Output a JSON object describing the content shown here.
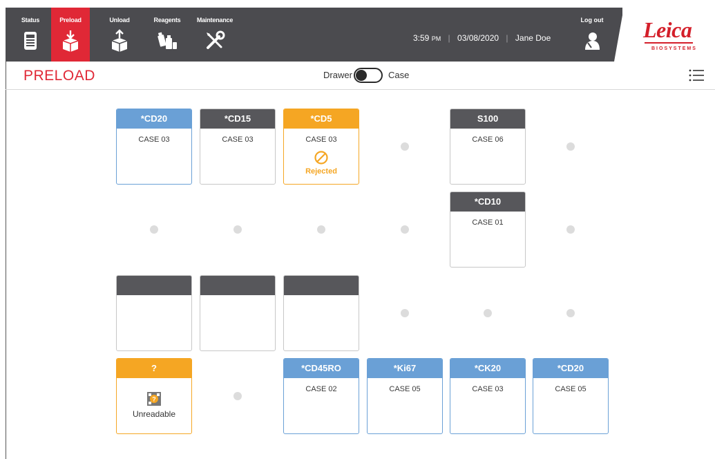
{
  "nav": {
    "items": [
      {
        "label": "Status",
        "icon": "instrument-icon"
      },
      {
        "label": "Preload",
        "icon": "tray-download-icon",
        "active": true
      },
      {
        "label": "Unload",
        "icon": "tray-upload-icon"
      },
      {
        "label": "Reagents",
        "icon": "reagent-bottles-icon"
      },
      {
        "label": "Maintenance",
        "icon": "tools-icon"
      }
    ],
    "time": "3:59",
    "ampm": "PM",
    "date": "03/08/2020",
    "user": "Jane Doe",
    "logout_label": "Log out"
  },
  "brand": {
    "name": "Leica",
    "sub": "BIOSYSTEMS",
    "color": "#d41f2a"
  },
  "page": {
    "title": "PRELOAD",
    "toggle_left": "Drawer",
    "toggle_right": "Case"
  },
  "colors": {
    "accent": "#e02836",
    "blue": "#6aa0d6",
    "gray": "#57575b",
    "orange": "#f5a623"
  },
  "grid": [
    [
      {
        "type": "card",
        "color": "blue",
        "marker": "*CD20",
        "case": "CASE 03"
      },
      {
        "type": "card",
        "color": "gray",
        "marker": "*CD15",
        "case": "CASE 03"
      },
      {
        "type": "card",
        "color": "orange",
        "marker": "*CD5",
        "case": "CASE 03",
        "status": "Rejected"
      },
      {
        "type": "empty"
      },
      {
        "type": "card",
        "color": "gray",
        "marker": "S100",
        "case": "CASE 06"
      },
      {
        "type": "empty"
      }
    ],
    [
      {
        "type": "empty"
      },
      {
        "type": "empty"
      },
      {
        "type": "empty"
      },
      {
        "type": "empty"
      },
      {
        "type": "card",
        "color": "gray",
        "marker": "*CD10",
        "case": "CASE 01"
      },
      {
        "type": "empty"
      }
    ],
    [
      {
        "type": "card",
        "color": "gray",
        "marker": "",
        "case": ""
      },
      {
        "type": "card",
        "color": "gray",
        "marker": "",
        "case": ""
      },
      {
        "type": "card",
        "color": "gray",
        "marker": "",
        "case": ""
      },
      {
        "type": "empty"
      },
      {
        "type": "empty"
      },
      {
        "type": "empty"
      }
    ],
    [
      {
        "type": "card",
        "color": "orange",
        "marker": "?",
        "case": "",
        "status": "Unreadable"
      },
      {
        "type": "empty"
      },
      {
        "type": "card",
        "color": "blue",
        "marker": "*CD45RO",
        "case": "CASE 02"
      },
      {
        "type": "card",
        "color": "blue",
        "marker": "*Ki67",
        "case": "CASE 05"
      },
      {
        "type": "card",
        "color": "blue",
        "marker": "*CK20",
        "case": "CASE 03"
      },
      {
        "type": "card",
        "color": "blue",
        "marker": "*CD20",
        "case": "CASE 05"
      }
    ]
  ]
}
